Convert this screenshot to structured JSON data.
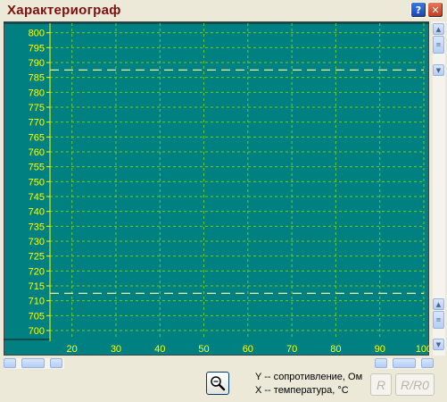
{
  "window": {
    "title": "Характериограф"
  },
  "title_buttons": {
    "help_label": "?",
    "close_label": "✕"
  },
  "legend": {
    "y_text": "Y -- сопротивление, Ом",
    "x_text": "X -- температура, °C"
  },
  "mode_buttons": {
    "r_label": "R",
    "rr0_label": "R/R0"
  },
  "colors": {
    "plot_background": "#008080",
    "grid": "#66cc33",
    "tick_labels": "#ffff00",
    "reference_lines": "#ffff99",
    "title": "#7a1010"
  },
  "icons": {
    "zoom": "magnifier-icon",
    "scroll_up": "arrow-up-icon",
    "scroll_down": "arrow-down-icon"
  },
  "chart_data": {
    "type": "line",
    "x_ticks": [
      20,
      30,
      40,
      50,
      60,
      70,
      80,
      90,
      100
    ],
    "y_ticks": [
      700,
      705,
      710,
      715,
      720,
      725,
      730,
      735,
      740,
      745,
      750,
      755,
      760,
      765,
      770,
      775,
      780,
      785,
      790,
      795,
      800
    ],
    "xlim": [
      15,
      100
    ],
    "ylim": [
      697,
      802
    ],
    "grid": true,
    "reference_lines": [
      {
        "y": 787.5,
        "style": "dashed"
      },
      {
        "y": 712.5,
        "style": "dashed"
      }
    ],
    "series": []
  }
}
